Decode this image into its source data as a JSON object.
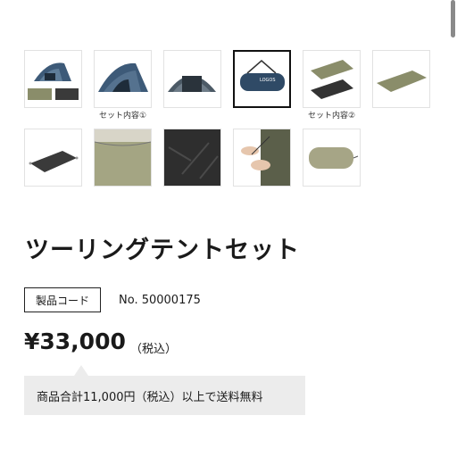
{
  "gallery": {
    "thumbnails": [
      {
        "name": "tent-set-overview",
        "caption": ""
      },
      {
        "name": "tent-angle-1",
        "caption": "セット内容①"
      },
      {
        "name": "tent-angle-2",
        "caption": ""
      },
      {
        "name": "carry-bag",
        "caption": "",
        "selected": true
      },
      {
        "name": "mats-set",
        "caption": "セット内容②"
      },
      {
        "name": "green-mat",
        "caption": ""
      },
      {
        "name": "ground-sheet",
        "caption": ""
      },
      {
        "name": "mat-detail",
        "caption": ""
      },
      {
        "name": "sheet-texture",
        "caption": ""
      },
      {
        "name": "hands-detail",
        "caption": ""
      },
      {
        "name": "stuff-sack",
        "caption": ""
      }
    ],
    "bag_logo": "LOGOS"
  },
  "product": {
    "title": "ツーリングテントセット",
    "code_label": "製品コード",
    "code_value": "No. 50000175",
    "price": "¥33,000",
    "tax_note": "（税込）",
    "shipping_note": "商品合計11,000円（税込）以上で送料無料"
  },
  "colors": {
    "tent_blue": "#3d5a78",
    "olive": "#8a8d6a",
    "dark": "#2b2b2b",
    "shipping_bg": "#ececec"
  }
}
